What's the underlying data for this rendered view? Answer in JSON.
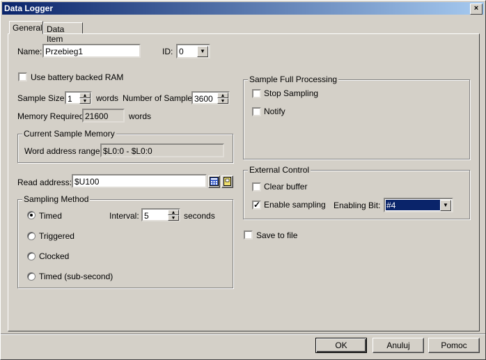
{
  "window": {
    "title": "Data Logger",
    "close_glyph": "×"
  },
  "tabs": [
    {
      "label": "General"
    },
    {
      "label": "Data Item"
    }
  ],
  "general": {
    "name_label": "Name:",
    "name_value": "Przebieg1",
    "id_label": "ID:",
    "id_value": "0",
    "battery_label": "Use battery backed RAM",
    "sample_size_label": "Sample Size:",
    "sample_size_value": "1",
    "words_label": "words",
    "num_samples_label": "Number of Samples:",
    "num_samples_value": "3600",
    "memory_required_label": "Memory Required:",
    "memory_required_value": "21600",
    "memory_words_label": "words",
    "current_sample_memory": {
      "title": "Current Sample Memory",
      "range_label": "Word address range:",
      "range_value": "$L0:0 - $L0:0"
    },
    "read_address_label": "Read address:",
    "read_address_value": "$U100",
    "sampling_method": {
      "title": "Sampling Method",
      "options": [
        {
          "label": "Timed",
          "selected": true
        },
        {
          "label": "Triggered",
          "selected": false
        },
        {
          "label": "Clocked",
          "selected": false
        },
        {
          "label": "Timed (sub-second)",
          "selected": false
        }
      ],
      "interval_label": "Interval:",
      "interval_value": "5",
      "seconds_label": "seconds"
    },
    "sample_full_processing": {
      "title": "Sample Full Processing",
      "stop_label": "Stop Sampling",
      "notify_label": "Notify"
    },
    "external_control": {
      "title": "External Control",
      "clear_label": "Clear buffer",
      "enable_label": "Enable sampling",
      "enable_checked": true,
      "bit_label": "Enabling Bit:",
      "bit_value": "#4"
    },
    "save_label": "Save to file"
  },
  "buttons": {
    "ok": "OK",
    "cancel": "Anuluj",
    "help": "Pomoc"
  },
  "colors": {
    "title_start": "#0a246a",
    "title_end": "#a6caf0",
    "selection": "#0a246a"
  }
}
